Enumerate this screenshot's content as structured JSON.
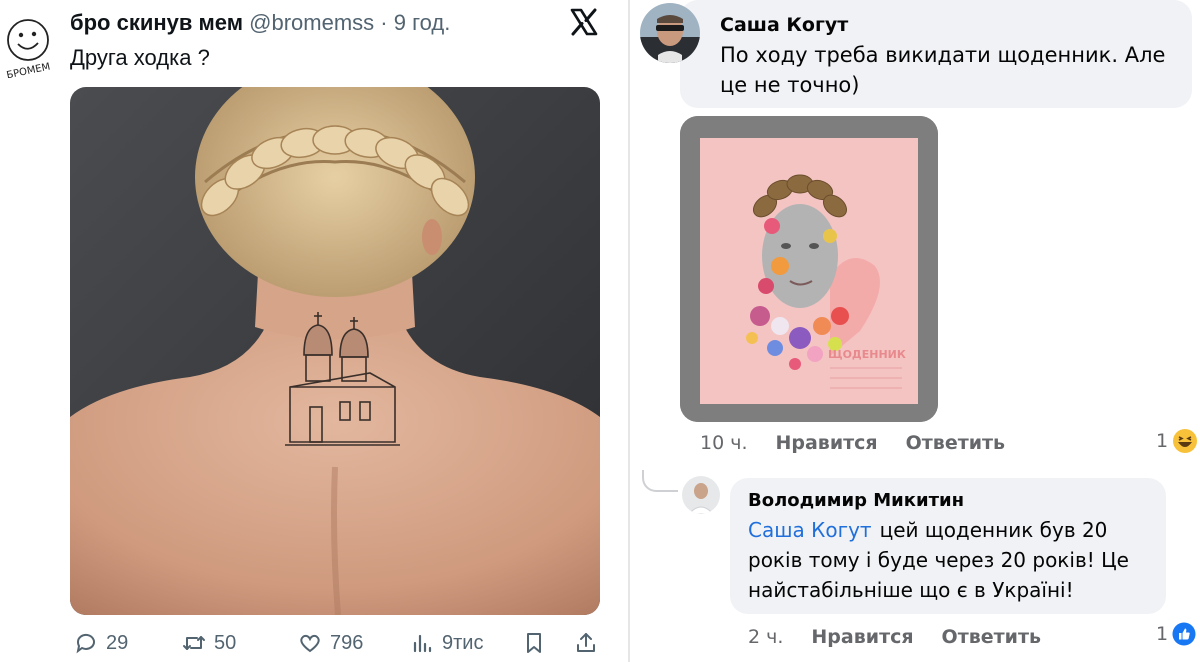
{
  "tweet": {
    "avatar_text": "БРОМЕМ",
    "display_name": "бро скинув мем",
    "handle": "@bromemss",
    "separator": "·",
    "time": "9 год.",
    "text": "Друга ходка ?",
    "stats": {
      "replies": "29",
      "reposts": "50",
      "likes": "796",
      "views": "9тис"
    }
  },
  "comments": [
    {
      "author": "Саша Когут",
      "text": "По ходу треба викидати щоденник. Але це не точно)",
      "sticker_caption": "ЩОДЕННИК",
      "time": "10 ч.",
      "like_label": "Нравится",
      "reply_label": "Ответить",
      "reaction_count": "1",
      "reaction_icon": "haha-emoji-icon"
    },
    {
      "author": "Володимир Микитин",
      "mention": "Саша Когут",
      "text": "цей щоденник був 20 років тому і буде через 20 років! Це найстабільніше що є в Україні!",
      "time": "2 ч.",
      "like_label": "Нравится",
      "reply_label": "Ответить",
      "reaction_count": "1",
      "reaction_icon": "like-thumb-icon"
    }
  ],
  "colors": {
    "twitter_text": "#0f1419",
    "twitter_meta": "#536471",
    "fb_bubble": "#f0f2f5",
    "fb_meta": "#65676b",
    "fb_link": "#216fdb",
    "fb_like_blue": "#1877f2",
    "sticker_pink": "#f6c5c4"
  }
}
